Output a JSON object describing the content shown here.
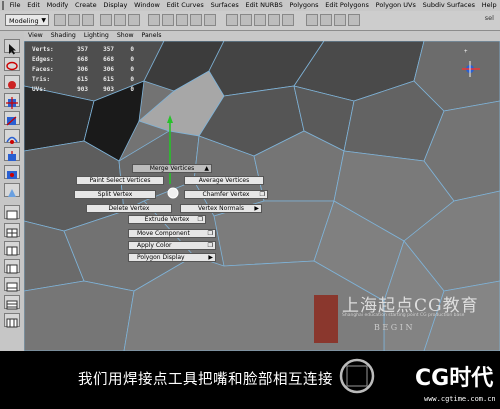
{
  "menubar": {
    "items": [
      "File",
      "Edit",
      "Modify",
      "Create",
      "Display",
      "Window",
      "Edit Curves",
      "Surfaces",
      "Edit NURBS",
      "Polygons",
      "Edit Polygons",
      "Polygon UVs",
      "Subdiv Surfaces",
      "Help"
    ]
  },
  "statusline": {
    "mode": "Modeling",
    "sel_label": "sel"
  },
  "panel_menu": {
    "items": [
      "View",
      "Shading",
      "Lighting",
      "Show",
      "Panels"
    ]
  },
  "hud": {
    "rows": [
      {
        "label": "Verts:",
        "a": "357",
        "b": "357",
        "c": "0"
      },
      {
        "label": "Edges:",
        "a": "668",
        "b": "668",
        "c": "0"
      },
      {
        "label": "Faces:",
        "a": "306",
        "b": "306",
        "c": "0"
      },
      {
        "label": "Tris:",
        "a": "615",
        "b": "615",
        "c": "0"
      },
      {
        "label": "UVs:",
        "a": "903",
        "b": "903",
        "c": "0"
      }
    ]
  },
  "marking_menu": {
    "merge_vertices": "Merge Vertices",
    "paint_select_vertices": "Paint Select Vertices",
    "average_vertices": "Average Vertices",
    "split_vertex": "Split Vertex",
    "chamfer_vertex": "Chamfer Vertex",
    "delete_vertex": "Delete Vertex",
    "vertex_normals": "Vertex Normals",
    "extrude_vertex": "Extrude Vertex",
    "move_component": "Move Component",
    "apply_color": "Apply Color",
    "polygon_display": "Polygon Display"
  },
  "watermark": {
    "school_name": "上海起点CG教育",
    "school_sub": "Shanghai education starting point CG production base",
    "begin": "B E G I N",
    "brand": "CG时代",
    "url": "www.cgtime.com.cn"
  },
  "caption": "我们用焊接点工具把嘴和脸部相互连接",
  "colors": {
    "viewport_bg": "#6e6e6e",
    "wire": "#7fb3d8",
    "manip_green": "#27c12a"
  }
}
